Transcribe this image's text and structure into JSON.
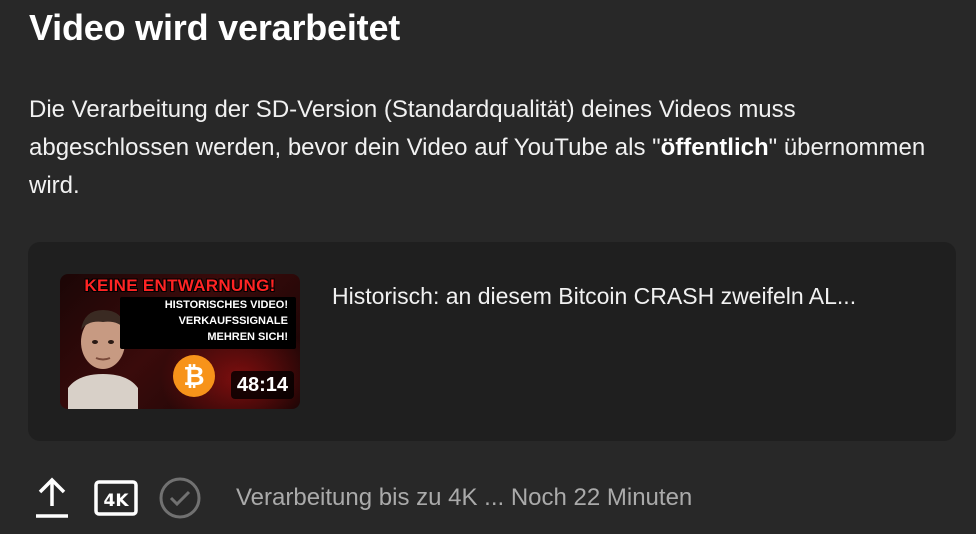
{
  "dialog": {
    "title": "Video wird verarbeitet",
    "description_part1": "Die Verarbeitung der SD-Version (Standardqualität) deines Videos muss abgeschlossen werden, bevor dein Video auf YouTube als \"",
    "description_bold": "öffentlich",
    "description_part2": "\" übernommen wird."
  },
  "video": {
    "title": "Historisch: an diesem Bitcoin CRASH zweifeln AL...",
    "duration": "48:14",
    "thumbnail": {
      "headline": "KEINE ENTWARNUNG!",
      "line1": "HISTORISCHES VIDEO!",
      "line2": "VERKAUFSSIGNALE",
      "line3": "MEHREN SICH!"
    }
  },
  "footer": {
    "icons": [
      "upload-icon",
      "4k-icon",
      "check-circle-icon"
    ],
    "status": "Verarbeitung bis zu 4K ... Noch 22 Minuten"
  },
  "colors": {
    "background": "#282828",
    "card": "#1f1f1f",
    "muted_text": "#aaaaaa",
    "thumbnail_red": "#ff2424",
    "bitcoin_orange": "#f7931a"
  }
}
